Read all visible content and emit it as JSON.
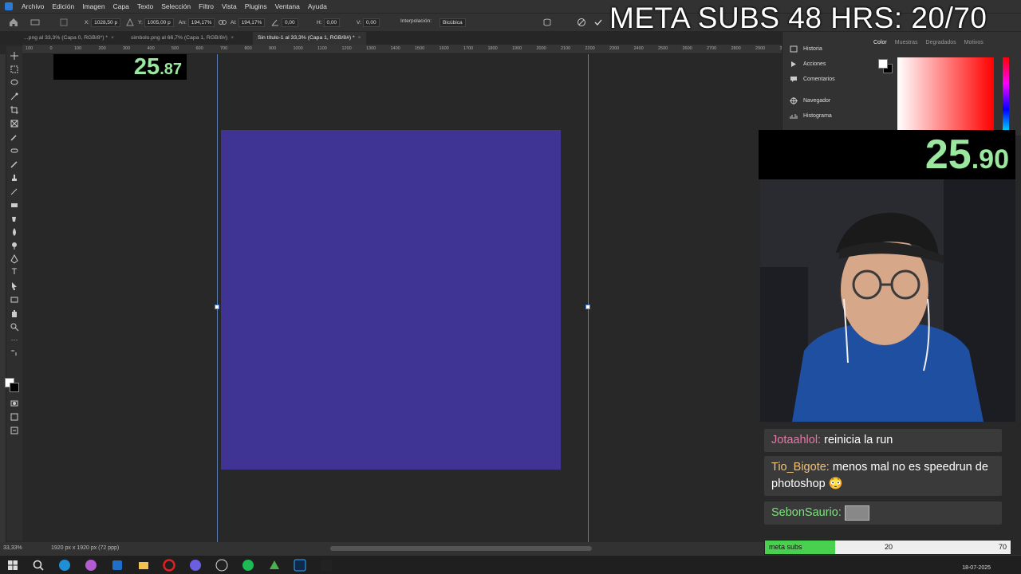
{
  "app": {
    "menu": [
      "Archivo",
      "Edición",
      "Imagen",
      "Capa",
      "Texto",
      "Selección",
      "Filtro",
      "Vista",
      "Plugins",
      "Ventana",
      "Ayuda"
    ]
  },
  "options": {
    "x_label": "X:",
    "x_value": "1028,50 p",
    "y_label": "Y:",
    "y_value": "1005,00 p",
    "w_label": "An:",
    "w_value": "194,17%",
    "h_label": "Al:",
    "h_value": "194,17%",
    "angle_value": "0,00",
    "hs_label": "H:",
    "hs_value": "0,00",
    "vs_label": "V:",
    "vs_value": "0,00",
    "interp_label": "Interpolación:",
    "interp_value": "Bicúbica"
  },
  "tabs": [
    {
      "label": "...png al 33,3% (Capa 0, RGB/8*) *"
    },
    {
      "label": "simbolo.png al 66,7% (Capa 1, RGB/8#)"
    },
    {
      "label": "Sin título-1 al 33,3% (Capa 1, RGB/8#) *"
    }
  ],
  "ruler": [
    "100",
    "0",
    "100",
    "200",
    "300",
    "400",
    "500",
    "600",
    "700",
    "800",
    "900",
    "1000",
    "1100",
    "1200",
    "1300",
    "1400",
    "1500",
    "1600",
    "1700",
    "1800",
    "1900",
    "2000",
    "2100",
    "2200",
    "2300",
    "2400",
    "2500",
    "2600",
    "2700",
    "2800",
    "2900",
    "3000"
  ],
  "canvas": {
    "fill_color": "#3f3393"
  },
  "timer_small": {
    "main": "25",
    "fraction": ".87"
  },
  "timer_big": {
    "main": "25",
    "fraction": ".90"
  },
  "status": {
    "zoom": "33,33%",
    "dims": "1920 px x 1920 px (72 ppp)"
  },
  "panels": {
    "items": [
      "Historia",
      "Acciones",
      "Comentarios",
      "Navegador",
      "Histograma"
    ],
    "tabs": [
      "Color",
      "Muestras",
      "Degradados",
      "Motivos"
    ]
  },
  "overlay": {
    "title": "META  SUBS 48 HRS: 20/70"
  },
  "chat": [
    {
      "user": "Jotaahlol:",
      "user_color": "#e27aa7",
      "text": "reinicia la run"
    },
    {
      "user": "Tio_Bigote:",
      "user_color": "#f0c27a",
      "text": "menos mal no es speedrun de photoshop 😳"
    },
    {
      "user": "SebonSaurio:",
      "user_color": "#7ee07e",
      "text": ""
    }
  ],
  "progress": {
    "label": "meta subs",
    "current": "20",
    "goal": "70",
    "fraction": 0.2857
  },
  "taskbar": {
    "date": "18-07-2025"
  }
}
